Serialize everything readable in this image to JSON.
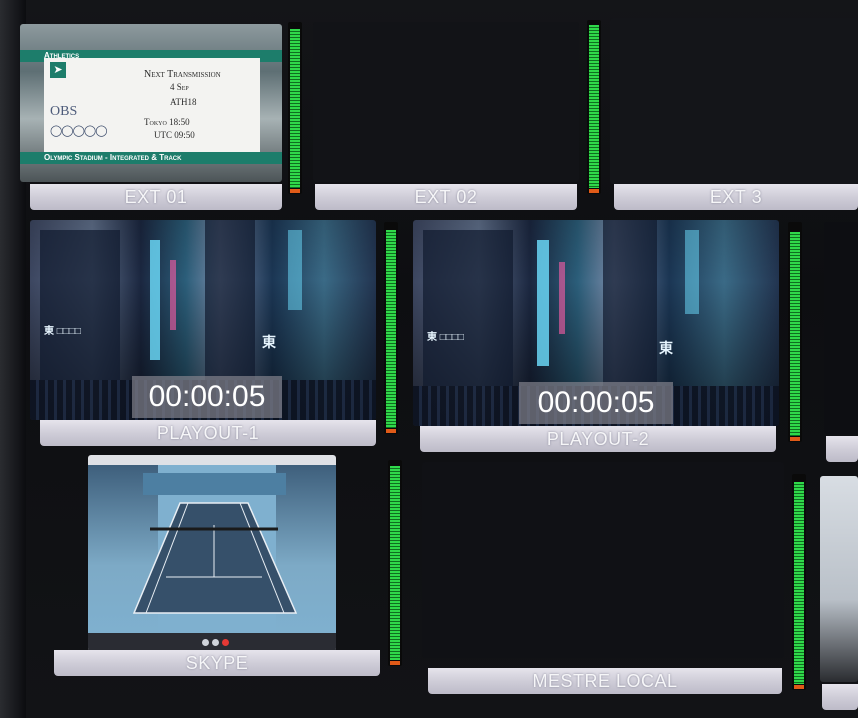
{
  "monitors": {
    "ext01": {
      "label": "EXT 01",
      "slate": {
        "sport": "Athletics",
        "heading": "Next Transmission",
        "date": "4 Sep",
        "code": "ATH18",
        "local_time": "Tokyo 18:50",
        "utc_time": "UTC 09:50",
        "broadcaster": "OBS",
        "venue": "Olympic Stadium - Integrated & Track"
      }
    },
    "ext02": {
      "label": "EXT 02"
    },
    "ext3": {
      "label": "EXT 3"
    },
    "playout1": {
      "label": "PLAYOUT-1",
      "timecode": "00:00:05"
    },
    "playout2": {
      "label": "PLAYOUT-2",
      "timecode": "00:00:05"
    },
    "skype": {
      "label": "SKYPE"
    },
    "mestre_local": {
      "label": "MESTRE LOCAL"
    }
  },
  "audio_meters": {
    "ext01": 0.97,
    "ext02": 0.98,
    "playout1": 0.97,
    "playout2": 0.96,
    "skype": 0.98,
    "mestre_local": 0.97
  },
  "colors": {
    "meter_green": "#30d94a",
    "meter_peak": "#e05a18",
    "label_bar": "#d8d6e0",
    "slate_accent": "#1d7d6b"
  }
}
